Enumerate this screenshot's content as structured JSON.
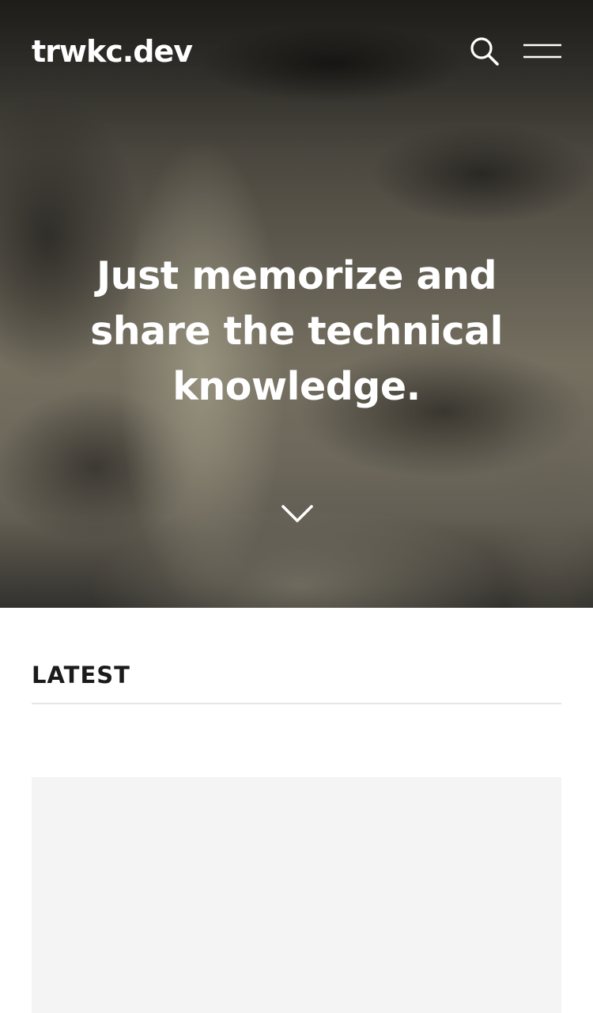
{
  "site": {
    "logo": "trwkc.dev"
  },
  "header": {
    "search_icon": "search-icon",
    "menu_icon": "hamburger-menu-icon"
  },
  "hero": {
    "title": "Just memorize and share the technical knowledge.",
    "scroll_icon": "chevron-down-icon"
  },
  "latest": {
    "heading": "LATEST"
  },
  "colors": {
    "hero_text": "#ffffff",
    "heading_text": "#1b1b1b",
    "divider": "#e6e6e6",
    "card_placeholder": "#f4f4f4"
  }
}
